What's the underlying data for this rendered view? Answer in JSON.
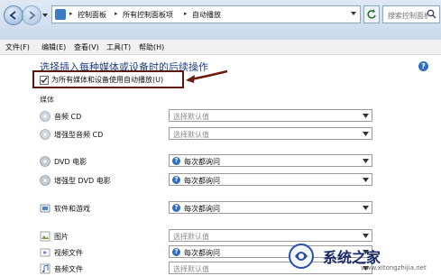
{
  "breadcrumb": {
    "items": [
      "控制面板",
      "所有控制面板项",
      "自动播放"
    ],
    "separator": "▸"
  },
  "search": {
    "placeholder": "搜索控制面板"
  },
  "menubar": {
    "items": [
      "文件(F)",
      "编辑(E)",
      "查看(V)",
      "工具(T)",
      "帮助(H)"
    ]
  },
  "content": {
    "headline": "选择插入每种媒体或设备时的后续操作",
    "autoplay_checkbox": {
      "label": "为所有媒体和设备使用自动播放(U)",
      "checked": true
    },
    "section_media": "媒体",
    "rows": [
      {
        "name": "音频 CD",
        "value": "选择默认值",
        "icon": "audio-cd-icon"
      },
      {
        "name": "增强型音频 CD",
        "value": "选择默认值",
        "icon": "enhanced-audio-cd-icon"
      },
      {
        "name": "DVD 电影",
        "value": "每次都询问",
        "icon": "dvd-movie-icon"
      },
      {
        "name": "增强型 DVD 电影",
        "value": "每次都询问",
        "icon": "enhanced-dvd-icon"
      },
      {
        "name": "软件和游戏",
        "value": "每次都询问",
        "icon": "software-games-icon"
      },
      {
        "name": "图片",
        "value": "选择默认值",
        "icon": "pictures-icon"
      },
      {
        "name": "视频文件",
        "value": "每次都询问",
        "icon": "video-files-icon"
      },
      {
        "name": "音频文件",
        "value": "选择默认值",
        "icon": "audio-files-icon"
      }
    ]
  },
  "watermark": {
    "text": "系统之家",
    "url": "www.xitongzhijia.net"
  },
  "colors": {
    "headline": "#1e3f86",
    "highlight_border": "#5a1a10",
    "arrow": "#6b1a10",
    "question_icon": "#2f6fc4"
  }
}
